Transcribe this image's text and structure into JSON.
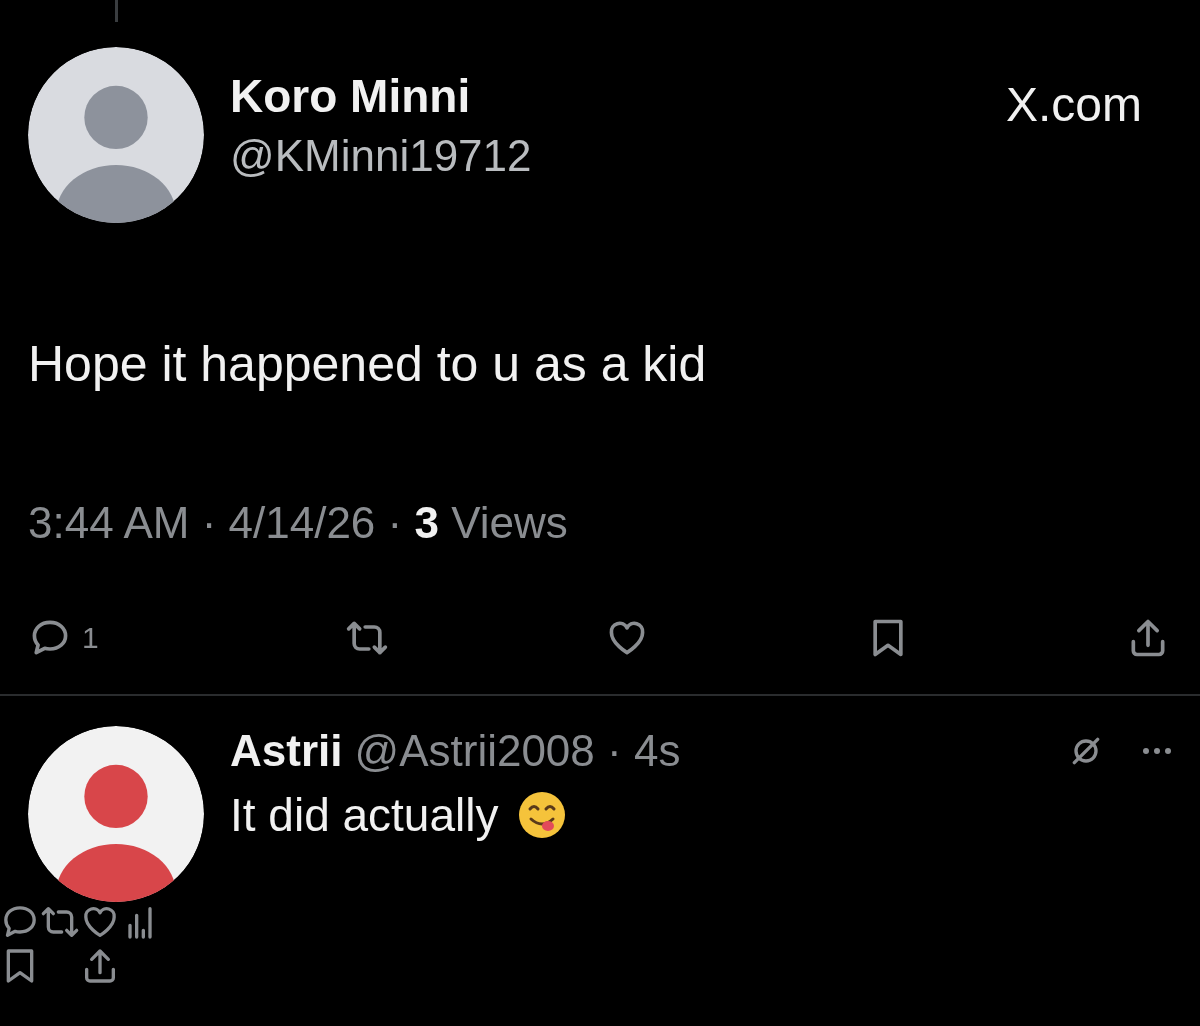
{
  "post": {
    "name": "Koro Minni",
    "handle": "@KMinni19712",
    "source": "X.com",
    "text": "Hope it happened to u as a kid",
    "meta": "3:44 AM · 4/14/26 · **3** Views",
    "reply_count": "1"
  },
  "reply": {
    "name": "Astrii",
    "handle_line": "@Astrii2008 · 4s",
    "text": "It did actually"
  }
}
